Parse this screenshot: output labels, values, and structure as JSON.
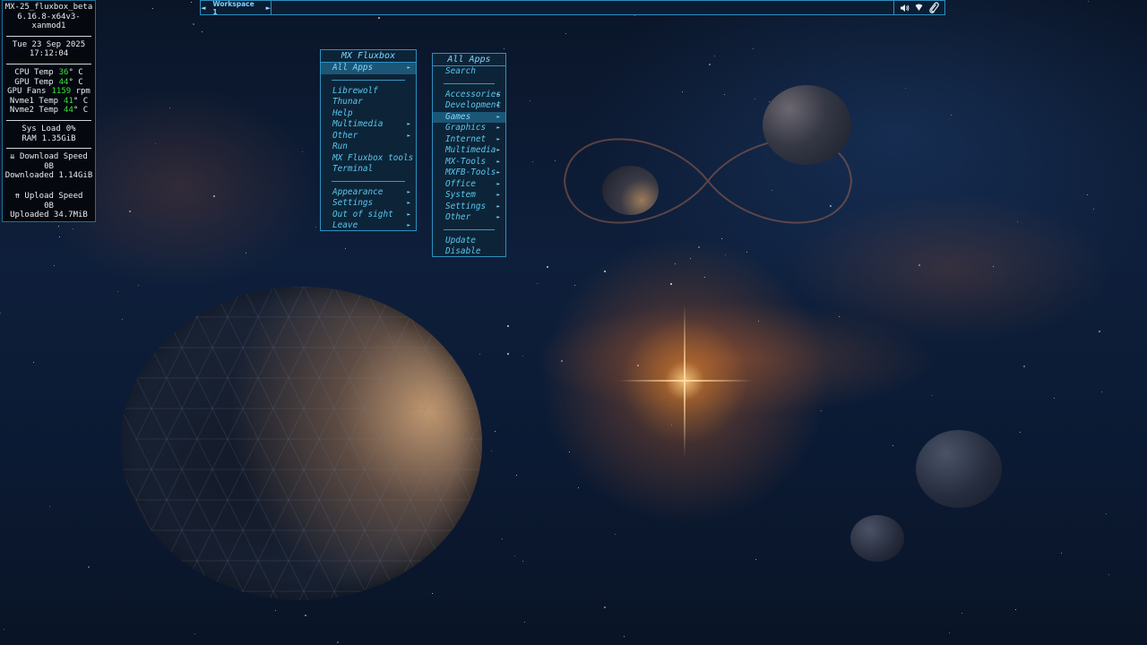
{
  "conky": {
    "hostname": "MX-25_fluxbox_beta",
    "kernel": "6.16.8-x64v3-xanmod1",
    "date": "Tue 23 Sep 2025",
    "time": "17:12:04",
    "sensors": [
      {
        "label": "CPU Temp",
        "value": "36",
        "unit": "° C"
      },
      {
        "label": "GPU Temp",
        "value": "44",
        "unit": "° C"
      },
      {
        "label": "GPU Fans",
        "value": "1159",
        "unit": "rpm"
      },
      {
        "label": "Nvme1 Temp",
        "value": "41",
        "unit": "° C"
      },
      {
        "label": "Nvme2 Temp",
        "value": "44",
        "unit": "° C"
      }
    ],
    "sys_load_label": "Sys Load",
    "sys_load_value": "0%",
    "ram_label": "RAM",
    "ram_value": "1.35GiB",
    "download_speed_label": "⇊ Download Speed",
    "download_speed_value": "0B",
    "downloaded": "Downloaded 1.14GiB",
    "upload_speed_label": "⇈ Upload Speed",
    "upload_speed_value": "0B",
    "uploaded": "Uploaded 34.7MiB",
    "value_color": "#34e23b"
  },
  "toolbar": {
    "workspace_label": "Workspace 1",
    "prev_arrow": "◄",
    "next_arrow": "►",
    "tray_icons": [
      "volume-icon",
      "network-icon",
      "clipboard-icon"
    ]
  },
  "mx_menu": {
    "title": "MX Fluxbox",
    "highlighted": "All Apps",
    "items_top": [
      {
        "label": "All Apps",
        "submenu": true
      }
    ],
    "items_mid": [
      {
        "label": "Librewolf",
        "submenu": false
      },
      {
        "label": "Thunar",
        "submenu": false
      },
      {
        "label": "Help",
        "submenu": false
      },
      {
        "label": "Multimedia",
        "submenu": true
      },
      {
        "label": "Other",
        "submenu": true
      },
      {
        "label": "Run",
        "submenu": false
      },
      {
        "label": "MX Fluxbox tools",
        "submenu": false
      },
      {
        "label": "Terminal",
        "submenu": false
      }
    ],
    "items_bottom": [
      {
        "label": "Appearance",
        "submenu": true
      },
      {
        "label": "Settings",
        "submenu": true
      },
      {
        "label": "Out of sight",
        "submenu": true
      },
      {
        "label": "Leave",
        "submenu": true
      }
    ]
  },
  "apps_menu": {
    "title": "All Apps",
    "highlighted": "Games",
    "items_top": [
      {
        "label": "Search",
        "submenu": false
      }
    ],
    "items_mid": [
      {
        "label": "Accessories",
        "submenu": true
      },
      {
        "label": "Development",
        "submenu": true
      },
      {
        "label": "Games",
        "submenu": true
      },
      {
        "label": "Graphics",
        "submenu": true
      },
      {
        "label": "Internet",
        "submenu": true
      },
      {
        "label": "Multimedia",
        "submenu": true
      },
      {
        "label": "MX-Tools",
        "submenu": true
      },
      {
        "label": "MXFB-Tools",
        "submenu": true
      },
      {
        "label": "Office",
        "submenu": true
      },
      {
        "label": "System",
        "submenu": true
      },
      {
        "label": "Settings",
        "submenu": true
      },
      {
        "label": "Other",
        "submenu": true
      }
    ],
    "items_bottom": [
      {
        "label": "Update",
        "submenu": false
      },
      {
        "label": "Disable",
        "submenu": false
      }
    ]
  },
  "colors": {
    "menu_bg": "#0d2438",
    "menu_border": "#2e8fbf",
    "menu_text": "#58c7ee",
    "menu_highlight": "#1c5676"
  }
}
